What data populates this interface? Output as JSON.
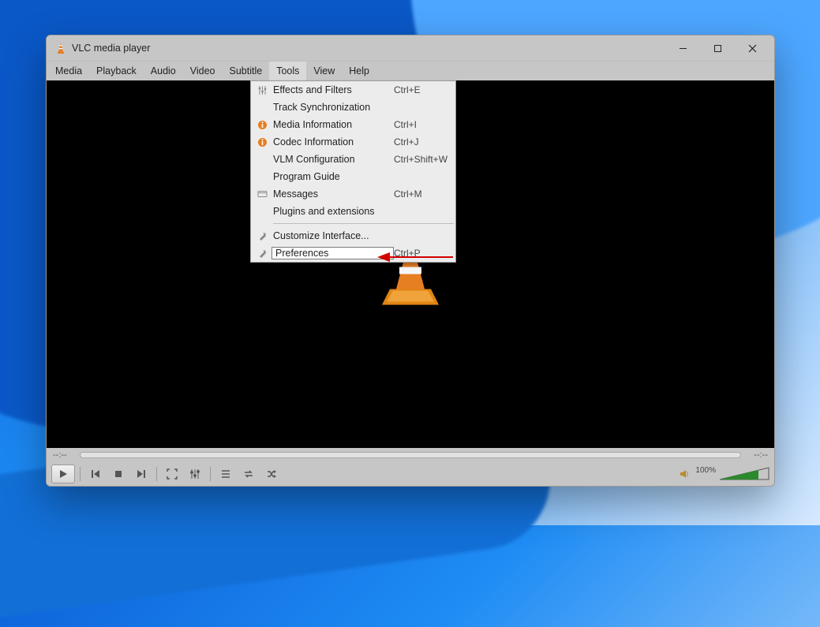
{
  "window": {
    "title": "VLC media player",
    "controls": {
      "min": "Minimize",
      "max": "Maximize",
      "close": "Close"
    }
  },
  "menubar": {
    "items": [
      {
        "label": "Media"
      },
      {
        "label": "Playback"
      },
      {
        "label": "Audio"
      },
      {
        "label": "Video"
      },
      {
        "label": "Subtitle"
      },
      {
        "label": "Tools",
        "open": true
      },
      {
        "label": "View"
      },
      {
        "label": "Help"
      }
    ]
  },
  "tools_menu": {
    "items": [
      {
        "icon": "sliders",
        "label": "Effects and Filters",
        "shortcut": "Ctrl+E"
      },
      {
        "icon": "",
        "label": "Track Synchronization",
        "shortcut": ""
      },
      {
        "icon": "info-orange",
        "label": "Media Information",
        "shortcut": "Ctrl+I"
      },
      {
        "icon": "info-orange",
        "label": "Codec Information",
        "shortcut": "Ctrl+J"
      },
      {
        "icon": "",
        "label": "VLM Configuration",
        "shortcut": "Ctrl+Shift+W"
      },
      {
        "icon": "",
        "label": "Program Guide",
        "shortcut": ""
      },
      {
        "icon": "message",
        "label": "Messages",
        "shortcut": "Ctrl+M"
      },
      {
        "icon": "",
        "label": "Plugins and extensions",
        "shortcut": ""
      },
      {
        "sep": true
      },
      {
        "icon": "wrench",
        "label": "Customize Interface...",
        "shortcut": ""
      },
      {
        "icon": "wrench",
        "label": "Preferences",
        "shortcut": "Ctrl+P",
        "highlight": true
      }
    ]
  },
  "footer": {
    "elapsed": "--:--",
    "remaining": "--:--",
    "volume_label": "100%"
  },
  "control_names": {
    "play": "Play",
    "prev": "Previous",
    "stop": "Stop",
    "next": "Next",
    "fullscreen": "Fullscreen",
    "ext": "Extended settings",
    "playlist": "Playlist",
    "loop": "Loop",
    "random": "Random",
    "mute": "Mute"
  }
}
